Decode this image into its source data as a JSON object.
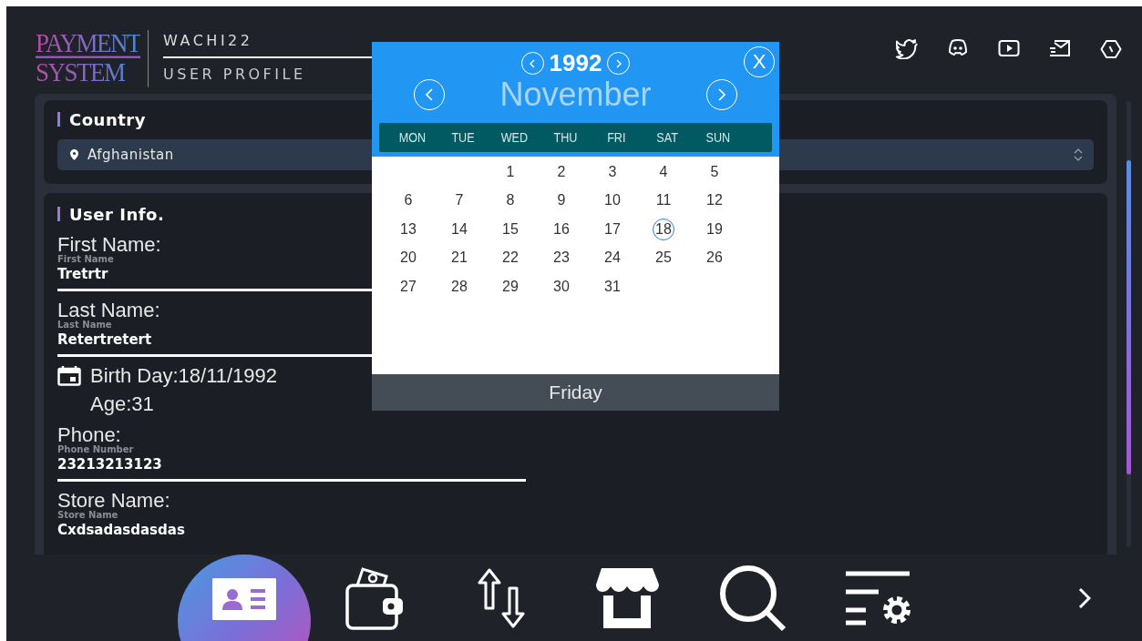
{
  "header": {
    "logo_top": "PAYMENT",
    "logo_bottom": "SYSTEM",
    "username": "WACHI22",
    "page_title": "USER PROFILE"
  },
  "country_card": {
    "title": "Country",
    "value": "Afghanistan"
  },
  "user_info": {
    "title": "User Info.",
    "fields": [
      {
        "label": "First Name:",
        "floating_label": "First Name",
        "value": "Tretrtr",
        "kind": "short"
      },
      {
        "label": "Last Name:",
        "floating_label": "Last Name",
        "value": "Retertretert",
        "kind": "short"
      }
    ],
    "birth_day": "Birth Day:18/11/1992",
    "age": "Age:31",
    "fields_after": [
      {
        "label": "Phone:",
        "floating_label": "Phone Number",
        "value": "23213213123",
        "kind": "long"
      },
      {
        "label": "Store Name:",
        "floating_label": "Store Name",
        "value": "Cxdsadasdasdas",
        "kind": "none"
      }
    ]
  },
  "calendar": {
    "year": "1992",
    "month": "November",
    "weekdays": [
      "MON",
      "TUE",
      "WED",
      "THU",
      "FRI",
      "SAT",
      "SUN"
    ],
    "weeks": [
      [
        {
          "kind": "empty"
        },
        {
          "kind": "empty"
        },
        {
          "kind": "day",
          "day": "1",
          "selected": false
        },
        {
          "kind": "day",
          "day": "2",
          "selected": false
        },
        {
          "kind": "day",
          "day": "3",
          "selected": false
        },
        {
          "kind": "day",
          "day": "4",
          "selected": false
        },
        {
          "kind": "day",
          "day": "5",
          "selected": false
        }
      ],
      [
        {
          "kind": "day",
          "day": "6",
          "selected": false
        },
        {
          "kind": "day",
          "day": "7",
          "selected": false
        },
        {
          "kind": "day",
          "day": "8",
          "selected": false
        },
        {
          "kind": "day",
          "day": "9",
          "selected": false
        },
        {
          "kind": "day",
          "day": "10",
          "selected": false
        },
        {
          "kind": "day",
          "day": "11",
          "selected": false
        },
        {
          "kind": "day",
          "day": "12",
          "selected": false
        }
      ],
      [
        {
          "kind": "day",
          "day": "13",
          "selected": false
        },
        {
          "kind": "day",
          "day": "14",
          "selected": false
        },
        {
          "kind": "day",
          "day": "15",
          "selected": false
        },
        {
          "kind": "day",
          "day": "16",
          "selected": false
        },
        {
          "kind": "day",
          "day": "17",
          "selected": false
        },
        {
          "kind": "day",
          "day": "18",
          "selected": true
        },
        {
          "kind": "day",
          "day": "19",
          "selected": false
        }
      ],
      [
        {
          "kind": "day",
          "day": "20",
          "selected": false
        },
        {
          "kind": "day",
          "day": "21",
          "selected": false
        },
        {
          "kind": "day",
          "day": "22",
          "selected": false
        },
        {
          "kind": "day",
          "day": "23",
          "selected": false
        },
        {
          "kind": "day",
          "day": "24",
          "selected": false
        },
        {
          "kind": "day",
          "day": "25",
          "selected": false
        },
        {
          "kind": "day",
          "day": "26",
          "selected": false
        }
      ],
      [
        {
          "kind": "day",
          "day": "27",
          "selected": false
        },
        {
          "kind": "day",
          "day": "28",
          "selected": false
        },
        {
          "kind": "day",
          "day": "29",
          "selected": false
        },
        {
          "kind": "day",
          "day": "30",
          "selected": false
        },
        {
          "kind": "day",
          "day": "31",
          "selected": false
        }
      ]
    ],
    "close": "X",
    "footer": "Friday"
  },
  "nav": {
    "items": [
      {
        "selected": true
      },
      {
        "selected": false
      },
      {
        "selected": false
      },
      {
        "selected": false
      },
      {
        "selected": false
      },
      {
        "selected": false
      }
    ]
  }
}
